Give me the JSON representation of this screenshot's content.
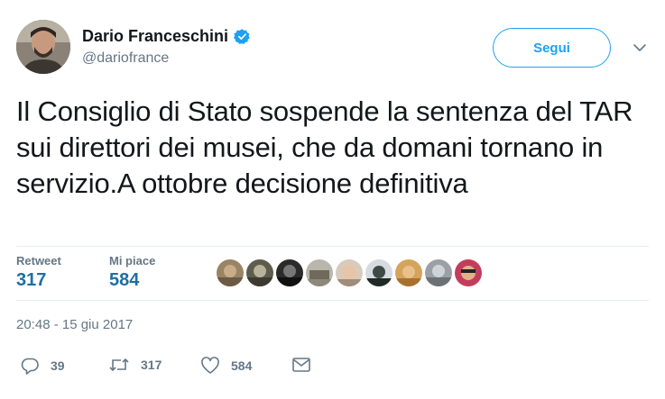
{
  "author": {
    "name": "Dario Franceschini",
    "handle": "@dariofrance",
    "verified": true
  },
  "follow_button": {
    "label": "Segui"
  },
  "tweet": {
    "text": "Il Consiglio di Stato sospende la sentenza del TAR sui direttori dei musei, che da domani tornano in servizio.A ottobre decisione definitiva",
    "timestamp": "20:48 - 15 giu 2017"
  },
  "stats": {
    "retweet_label": "Retweet",
    "retweet_count": "317",
    "likes_label": "Mi piace",
    "likes_count": "584"
  },
  "actions": {
    "reply_count": "39",
    "retweet_count": "317",
    "like_count": "584"
  },
  "colors": {
    "accent": "#1da1f2",
    "stat_value": "#1c6fa4",
    "muted": "#657786",
    "divider": "#e6ecf0"
  }
}
